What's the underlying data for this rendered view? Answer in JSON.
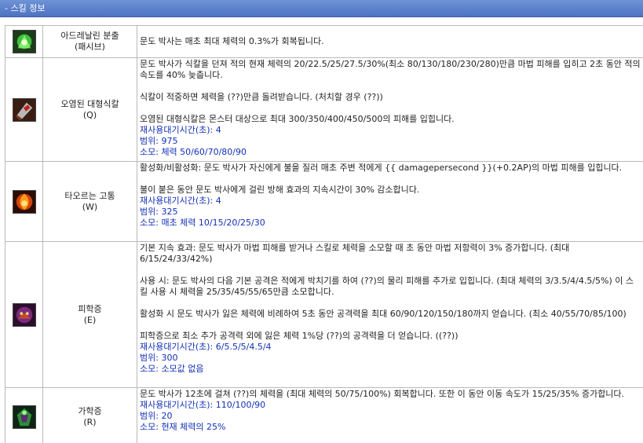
{
  "header": {
    "title": "- 스킬 정보"
  },
  "skills": [
    {
      "name": "아드레날린 분출",
      "key": "(패시브)",
      "icon": "adrenaline-rush-icon",
      "desc": [
        "문도 박사는 매초 최대 체력의 0.3%가 회복됩니다."
      ],
      "stats": []
    },
    {
      "name": "오염된 대형식칼",
      "key": "(Q)",
      "icon": "cleaver-icon",
      "desc": [
        "문도 박사가 식칼을 던져 적의 현재 체력의 20/22.5/25/27.5/30%(최소 80/130/180/230/280)만큼 마법 피해를 입히고 2초 동안 적의 속도를 40% 늦춥니다.",
        "",
        "식칼이 적중하면 체력을 (??)만큼 돌려받습니다. (처치할 경우 (??))",
        "",
        "오염된 대형식칼은 몬스터 대상으로 최대 300/350/400/450/500의 피해를 입힙니다."
      ],
      "stats": [
        "재사용대기시간(초): 4",
        "범위: 975",
        "소모: 체력 50/60/70/80/90"
      ]
    },
    {
      "name": "타오르는 고통",
      "key": "(W)",
      "icon": "burning-agony-icon",
      "desc": [
        "활성화/비활성화: 문도 박사가 자신에게 불을 질러 매초 주변 적에게 {{ damagepersecond }}(+0.2AP)의 마법 피해를 입힙니다.",
        "",
        "불이 붙은 동안 문도 박사에게 걸린 방해 효과의 지속시간이 30% 감소합니다."
      ],
      "stats": [
        "재사용대기시간(초): 4",
        "범위: 325",
        "소모: 매초 체력 10/15/20/25/30"
      ]
    },
    {
      "name": "피학증",
      "key": "(E)",
      "icon": "masochism-icon",
      "desc": [
        "기본 지속 효과: 문도 박사가 마법 피해를 받거나 스킬로 체력을 소모할 때 초 동안 마법 저항력이 3% 증가합니다. (최대 6/15/24/33/42%)",
        "",
        "사용 시: 문도 박사의 다음 기본 공격은 적에게 박치기를 하여 (??)의 물리 피해를 추가로 입힙니다. (최대 체력의 3/3.5/4/4.5/5%) 이 스킬 사용 시 체력을 25/35/45/55/65만큼 소모합니다.",
        "",
        "활성화 시 문도 박사가 잃은 체력에 비례하여 5초 동안 공격력을 최대 60/90/120/150/180까지 얻습니다. (최소 40/55/70/85/100)",
        "",
        "피학증으로 최소 추가 공격력 외에 잃은 체력 1%당 (??)의 공격력을 더 얻습니다. ((??))"
      ],
      "stats": [
        "재사용대기시간(초): 6/5.5/5/4.5/4",
        "범위: 300",
        "소모: 소모값 없음"
      ]
    },
    {
      "name": "가학증",
      "key": "(R)",
      "icon": "sadism-icon",
      "desc": [
        "문도 박사가 12초에 걸쳐 (??)의 체력을 (최대 체력의 50/75/100%) 회복합니다. 또한 이 동안 이동 속도가 15/25/35% 증가합니다."
      ],
      "stats": [
        "재사용대기시간(초): 110/100/90",
        "범위: 20",
        "소모: 현재 체력의 25%"
      ]
    }
  ]
}
